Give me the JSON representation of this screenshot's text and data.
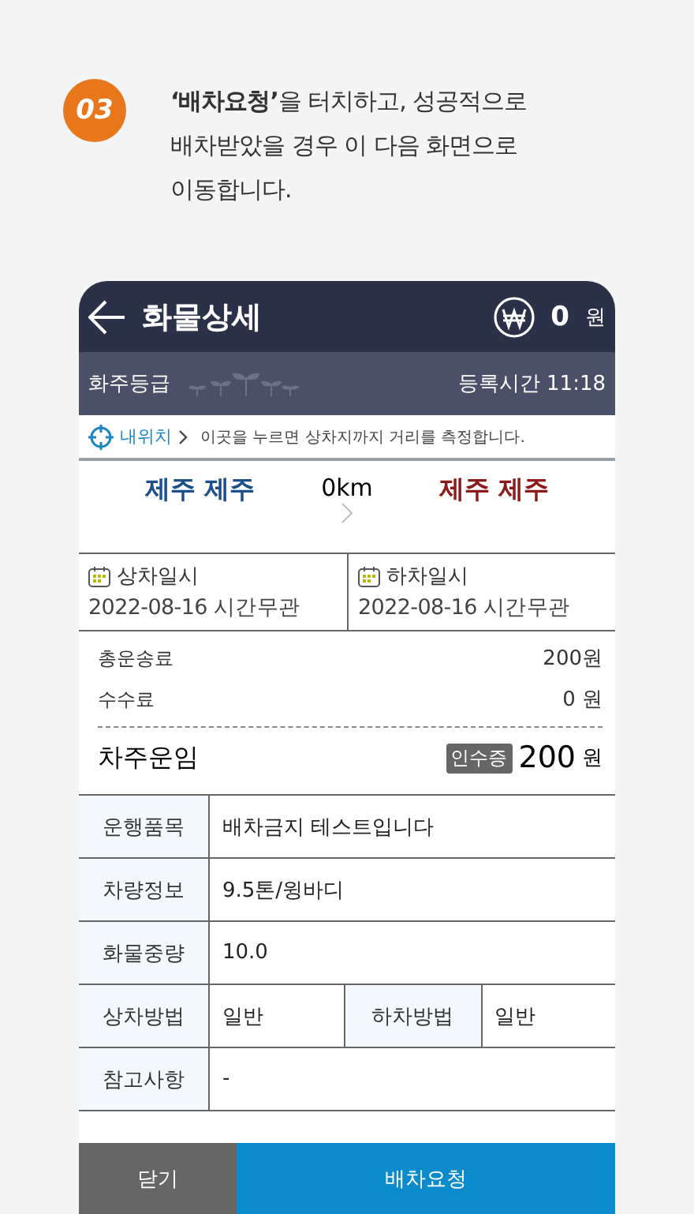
{
  "step": {
    "number": "03",
    "text": "**‘배차요청’**을 터치하고, 성공적으로 배차받았을 경우 이 다음 화면으로 이동합니다."
  },
  "header": {
    "title": "화물상세",
    "amount": "0",
    "unit": "원"
  },
  "grade_bar": {
    "label": "화주등급",
    "registered_label": "등록시간",
    "registered_time": "11:18"
  },
  "location": {
    "link": "내위치",
    "hint": "이곳을 누르면 상차지까지 거리를 측정합니다."
  },
  "route": {
    "origin": "제주 제주",
    "distance": "0km",
    "destination": "제주 제주"
  },
  "dates": [
    {
      "label": "상차일시",
      "value": "2022-08-16 시간무관"
    },
    {
      "label": "하차일시",
      "value": "2022-08-16 시간무관"
    }
  ],
  "fees": [
    {
      "label": "총운송료",
      "value": "200원"
    },
    {
      "label": "수수료",
      "value": "0 원"
    }
  ],
  "driver_fare": {
    "label": "차주운임",
    "tag": "인수증",
    "amount": "200",
    "unit": "원"
  },
  "details": [
    {
      "cells": [
        {
          "label": "운행품목",
          "value": "배차금지 테스트입니다"
        }
      ]
    },
    {
      "cells": [
        {
          "label": "차량정보",
          "value": "9.5톤/윙바디"
        }
      ]
    },
    {
      "cells": [
        {
          "label": "화물중량",
          "value": "10.0"
        }
      ]
    },
    {
      "cells": [
        {
          "label": "상차방법",
          "value": "일반"
        },
        {
          "label": "하차방법",
          "value": "일반"
        }
      ]
    },
    {
      "cells": [
        {
          "label": "참고사항",
          "value": "-"
        }
      ]
    }
  ],
  "buttons": [
    {
      "kind": "secondary",
      "label": "닫기"
    },
    {
      "kind": "primary",
      "label": "배차요청"
    }
  ]
}
